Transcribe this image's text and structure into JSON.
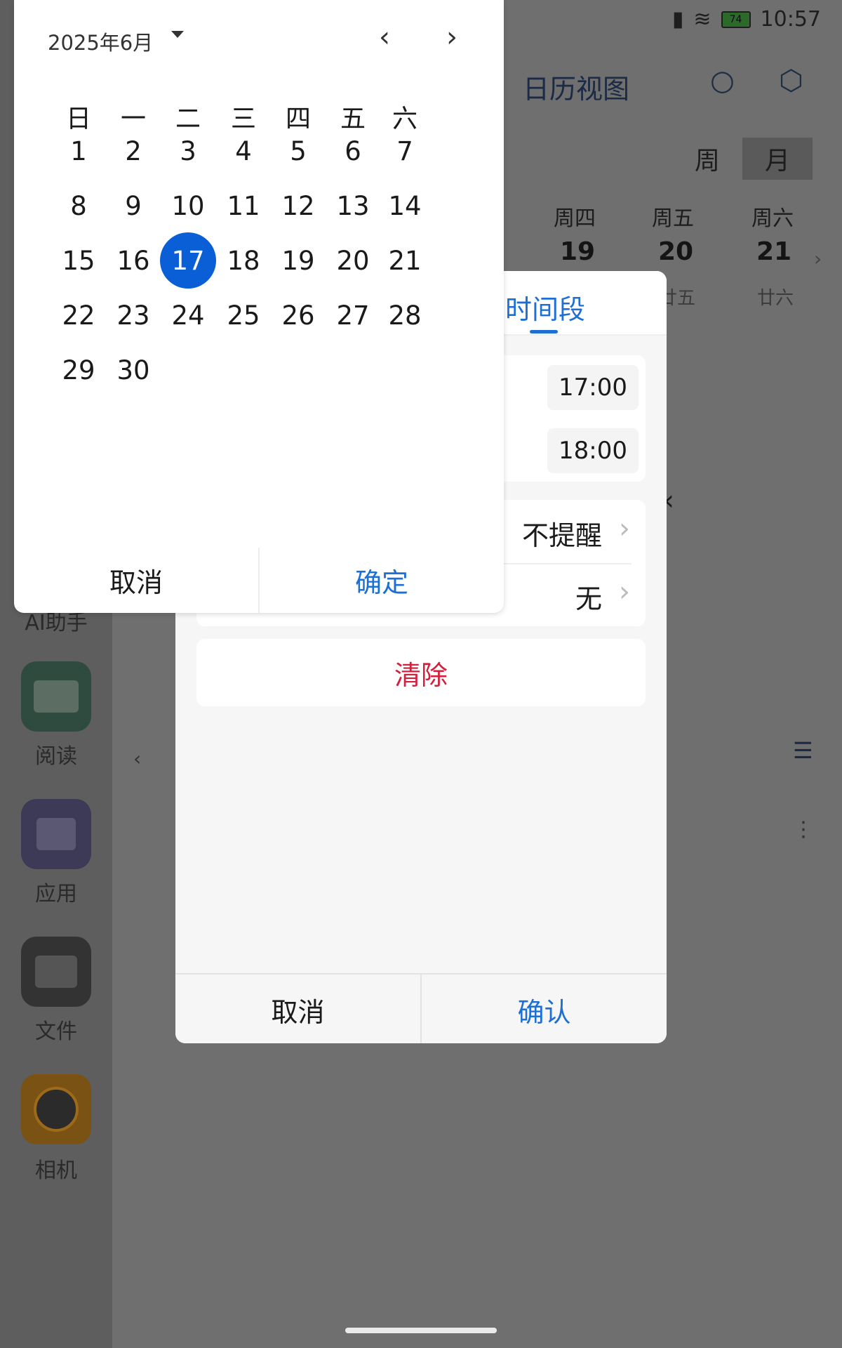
{
  "status_bar": {
    "battery": "74",
    "time": "10:57"
  },
  "background": {
    "title": "日历视图",
    "view_toggle": {
      "week": "周",
      "month": "月"
    },
    "days": [
      {
        "weekday": "周四",
        "date": "19",
        "lunar": ""
      },
      {
        "weekday": "周五",
        "date": "20",
        "lunar": "廿五"
      },
      {
        "weekday": "周六",
        "date": "21",
        "lunar": "廿六"
      }
    ],
    "dock": [
      {
        "label": "AI助手"
      },
      {
        "label": "阅读"
      },
      {
        "label": "应用"
      },
      {
        "label": "文件"
      },
      {
        "label": "相机"
      }
    ]
  },
  "dialog": {
    "tab_label": "时间段",
    "start_time": "17:00",
    "end_time": "18:00",
    "reminder_value": "不提醒",
    "repeat_value": "无",
    "clear_label": "清除",
    "cancel_label": "取消",
    "confirm_label": "确认"
  },
  "date_picker": {
    "month_label": "2025年6月",
    "weekdays": [
      "日",
      "一",
      "二",
      "三",
      "四",
      "五",
      "六"
    ],
    "days": [
      "1",
      "2",
      "3",
      "4",
      "5",
      "6",
      "7",
      "8",
      "9",
      "10",
      "11",
      "12",
      "13",
      "14",
      "15",
      "16",
      "17",
      "18",
      "19",
      "20",
      "21",
      "22",
      "23",
      "24",
      "25",
      "26",
      "27",
      "28",
      "29",
      "30"
    ],
    "selected_day": "17",
    "first_weekday_index": 0,
    "cancel_label": "取消",
    "confirm_label": "确定"
  },
  "colors": {
    "accent": "#0a5fd6",
    "danger": "#d21f3c",
    "link_blue": "#1e6fd4"
  }
}
